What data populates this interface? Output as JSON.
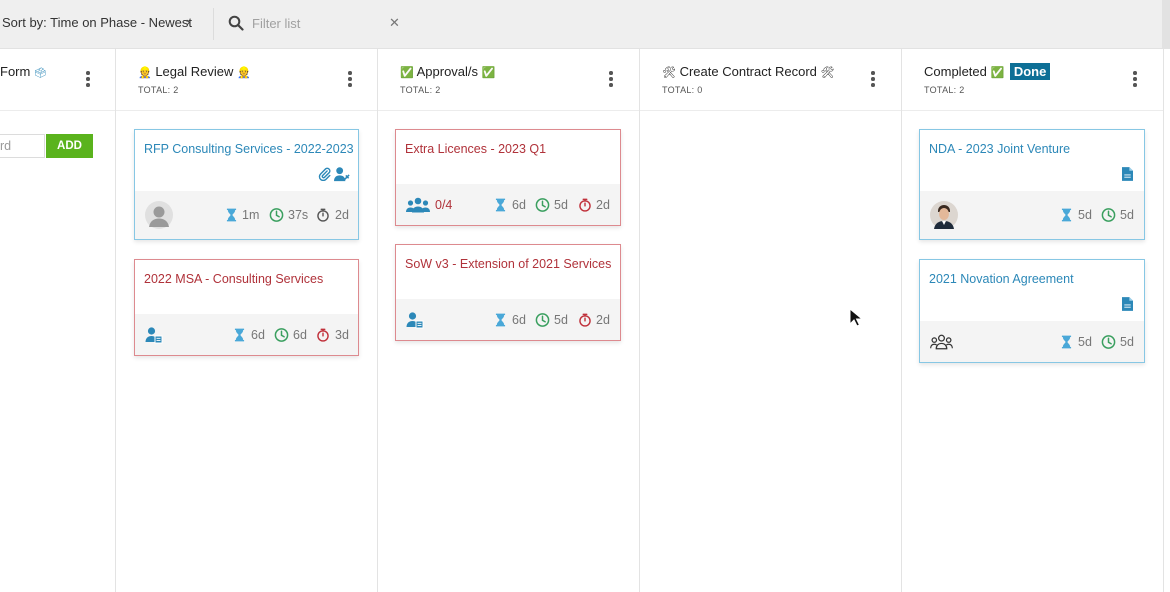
{
  "toolbar": {
    "sort_label": "Sort by: Time on Phase - Newest",
    "sort_chevron": "›",
    "filter_placeholder": "Filter list",
    "clear_symbol": "✕"
  },
  "columns": [
    {
      "title": "Form",
      "emoji_right": "🗳",
      "quick_add": {
        "placeholder": "rd",
        "button": "ADD"
      }
    },
    {
      "title": "Legal Review",
      "emoji": "👷",
      "total": "TOTAL: 2",
      "cards": [
        {
          "title": "RFP Consulting Services - 2022-2023",
          "icons": [
            "paperclip-icon",
            "user-edit-icon"
          ],
          "metrics": [
            "1m",
            "37s",
            "2d"
          ],
          "avatar": "default-avatar"
        },
        {
          "title": "2022 MSA - Consulting Services",
          "metrics": [
            "6d",
            "6d",
            "3d"
          ],
          "avatar": "user-form-icon"
        }
      ]
    },
    {
      "title": "Approval/s",
      "emoji": "✅",
      "total": "TOTAL: 2",
      "cards": [
        {
          "title": "Extra Licences - 2023 Q1",
          "group_count": "0/4",
          "metrics": [
            "6d",
            "5d",
            "2d"
          ]
        },
        {
          "title": "SoW v3 - Extension of 2021 Services",
          "metrics": [
            "6d",
            "5d",
            "2d"
          ]
        }
      ]
    },
    {
      "title": "Create Contract Record",
      "emoji": "🛠",
      "total": "TOTAL: 0"
    },
    {
      "title": "Completed",
      "emoji": "✅",
      "badge": "Done",
      "total": "TOTAL: 2",
      "cards": [
        {
          "title": "NDA - 2023 Joint Venture",
          "metrics": [
            "5d",
            "5d"
          ]
        },
        {
          "title": "2021 Novation Agreement",
          "metrics": [
            "5d",
            "5d"
          ]
        }
      ]
    }
  ],
  "colors": {
    "accent": "#2c88b8",
    "overdue": "#b0323a",
    "timer_green": "#3a9f5f",
    "timer_red": "#c0303a",
    "hourglass": "#4aa8d8",
    "add_button": "#5ab31d",
    "done_badge": "#0d6f96"
  }
}
